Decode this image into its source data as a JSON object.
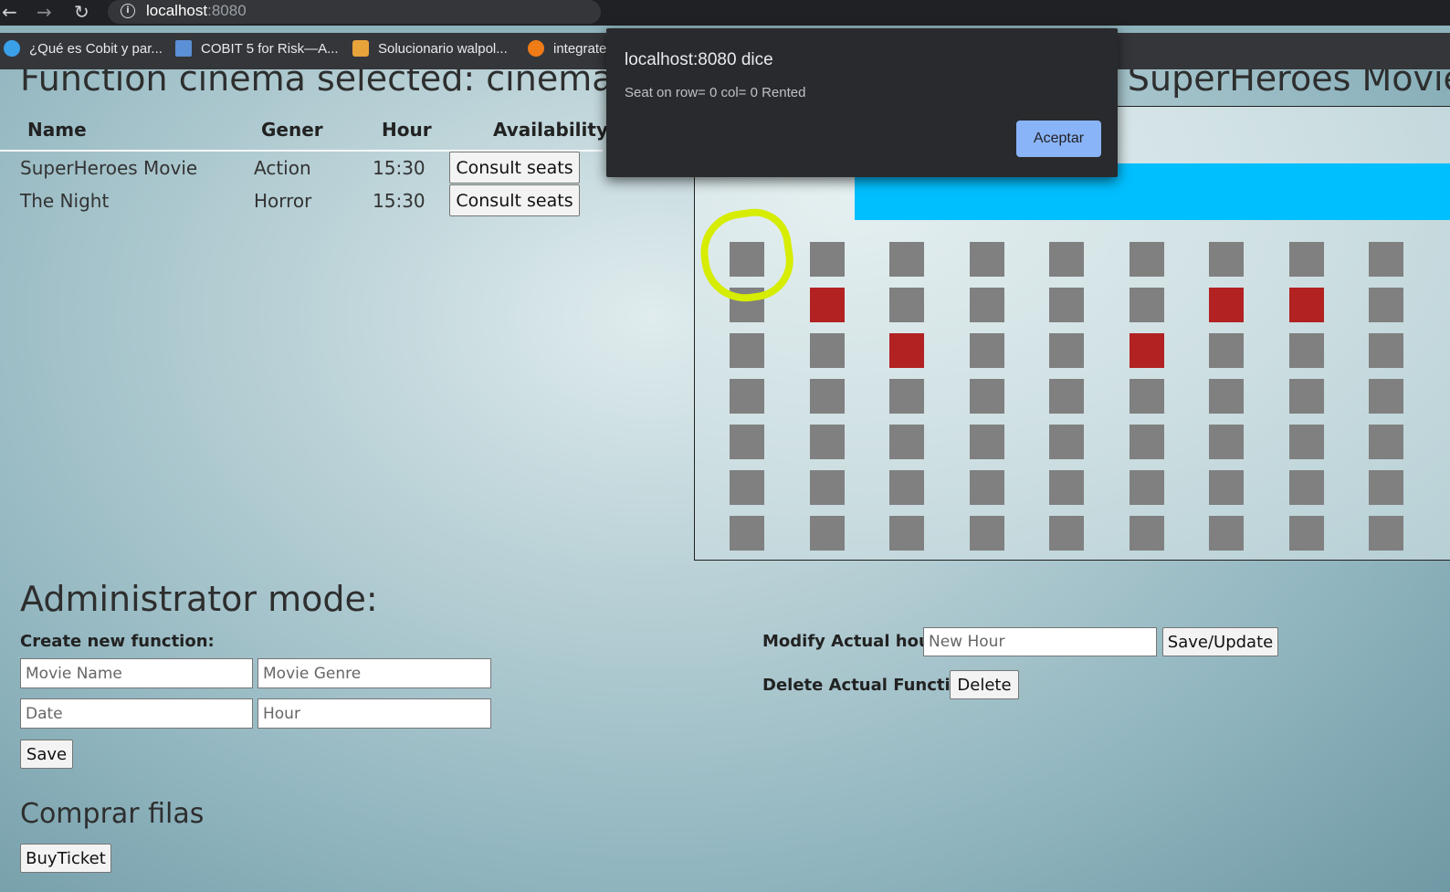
{
  "browser": {
    "url_host": "localhost",
    "url_port": ":8080",
    "bookmarks": [
      {
        "label": "¿Qué es Cobit y par...",
        "icon": "edge-icon",
        "color": "#3aa0e8"
      },
      {
        "label": "COBIT 5 for Risk—A...",
        "icon": "grid-icon",
        "color": "#5b8fd6"
      },
      {
        "label": "Solucionario walpol...",
        "icon": "doc-icon",
        "color": "#e8a33a"
      },
      {
        "label": "integrate",
        "icon": "gear-icon",
        "color": "#f07c18"
      }
    ]
  },
  "page": {
    "title": "Function cinema selected: cinemaX",
    "movie_title": ": SuperHeroes Movie",
    "table": {
      "headers": [
        "Name",
        "Gener",
        "Hour",
        "Availability"
      ],
      "rows": [
        {
          "name": "SuperHeroes Movie",
          "genre": "Action",
          "hour": "15:30",
          "button": "Consult seats"
        },
        {
          "name": "The Night",
          "genre": "Horror",
          "hour": "15:30",
          "button": "Consult seats"
        }
      ]
    },
    "seats": {
      "rows": 7,
      "cols": 9,
      "available_color": "#808080",
      "rented_color": "#b22222",
      "rented": [
        [
          1,
          1
        ],
        [
          1,
          6
        ],
        [
          1,
          7
        ],
        [
          2,
          2
        ],
        [
          2,
          5
        ]
      ],
      "highlighted_seat": [
        0,
        0
      ]
    },
    "admin": {
      "title": "Administrator mode:",
      "create_label": "Create new function:",
      "movie_name_placeholder": "Movie Name",
      "movie_genre_placeholder": "Movie Genre",
      "date_placeholder": "Date",
      "hour_placeholder": "Hour",
      "save_label": "Save",
      "modify_label": "Modify Actual hour:",
      "new_hour_placeholder": "New Hour",
      "save_update_label": "Save/Update",
      "delete_label": "Delete Actual Function:",
      "delete_button": "Delete"
    },
    "buy": {
      "title": "Comprar filas",
      "button": "BuyTicket"
    }
  },
  "dialog": {
    "title": "localhost:8080 dice",
    "message": "Seat on row= 0 col= 0 Rented",
    "ok_label": "Aceptar"
  }
}
